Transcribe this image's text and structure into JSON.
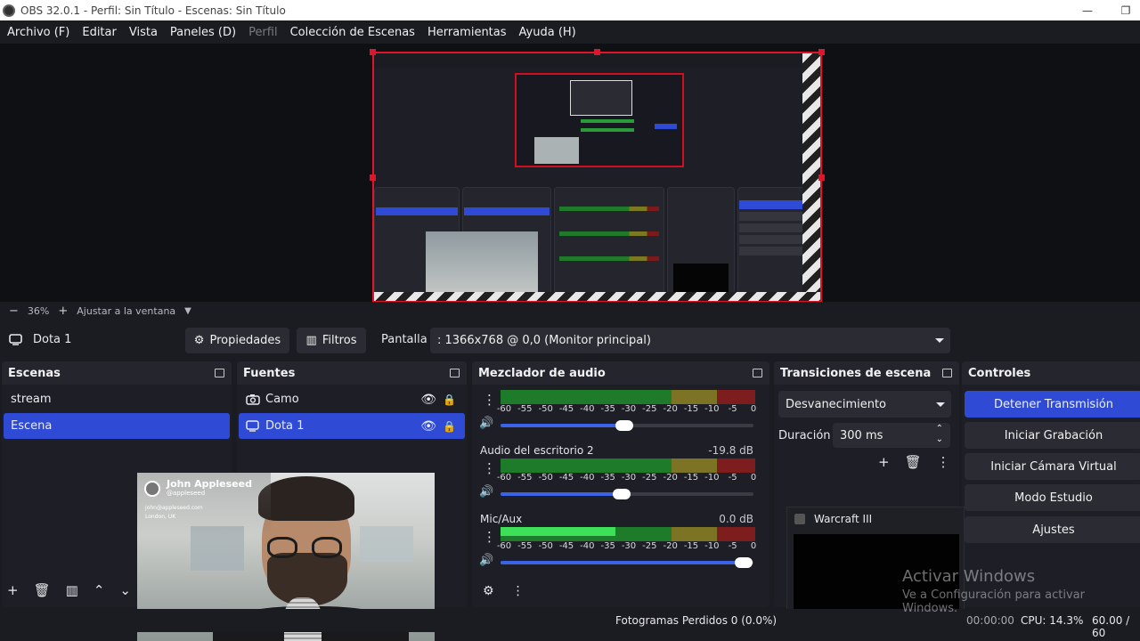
{
  "window": {
    "title": "OBS 32.0.1 - Perfil: Sin Título - Escenas: Sin Título",
    "minimize_icon": "—",
    "maximize_icon": "❐"
  },
  "menu": [
    {
      "label": "Archivo (F)",
      "enabled": true
    },
    {
      "label": "Editar",
      "enabled": true
    },
    {
      "label": "Vista",
      "enabled": true
    },
    {
      "label": "Paneles (D)",
      "enabled": true
    },
    {
      "label": "Perfil",
      "enabled": false
    },
    {
      "label": "Colección de Escenas",
      "enabled": true
    },
    {
      "label": "Herramientas",
      "enabled": true
    },
    {
      "label": "Ayuda (H)",
      "enabled": true
    }
  ],
  "zoom": {
    "minus": "−",
    "value": "36%",
    "plus": "+",
    "fit_label": "Ajustar a la ventana",
    "dropdown_icon": "▼"
  },
  "source_toolbar": {
    "source_name": "Dota 1",
    "properties_label": "Propiedades",
    "filters_label": "Filtros",
    "screen_label": "Pantalla",
    "screen_value": ": 1366x768 @ 0,0 (Monitor principal)"
  },
  "scenes": {
    "title": "Escenas",
    "items": [
      "stream",
      "Escena"
    ],
    "selected_index": 1
  },
  "sources": {
    "title": "Fuentes",
    "items": [
      {
        "name": "Camo",
        "icon": "camera-icon"
      },
      {
        "name": "Dota 1",
        "icon": "monitor-icon"
      }
    ],
    "selected_index": 1
  },
  "mixer": {
    "title": "Mezclador de audio",
    "scale": [
      "-60",
      "-55",
      "-50",
      "-45",
      "-40",
      "-35",
      "-30",
      "-25",
      "-20",
      "-15",
      "-10",
      "-5",
      "0"
    ],
    "channels": [
      {
        "name": "",
        "db": "",
        "volume": 0.49,
        "level": 0.0
      },
      {
        "name": "Audio del escritorio 2",
        "db": "-19.8 dB",
        "volume": 0.48,
        "level": 0.0
      },
      {
        "name": "Mic/Aux",
        "db": "0.0 dB",
        "volume": 0.96,
        "level": 0.45
      }
    ]
  },
  "transitions": {
    "title": "Transiciones de escena",
    "selected": "Desvanecimiento",
    "duration_label": "Duración",
    "duration_value": "300 ms"
  },
  "controls": {
    "title": "Controles",
    "buttons": [
      "Detener Transmisión",
      "Iniciar Grabación",
      "Iniciar Cámara Virtual",
      "Modo Estudio",
      "Ajustes"
    ]
  },
  "popup": {
    "title": "Warcraft III"
  },
  "webcam_overlay": {
    "name": "John Appleseed",
    "handle": "@appleseed",
    "email": "john@appleseed.com",
    "location": "London, UK"
  },
  "status": {
    "dropped_frames": "Fotogramas Perdidos 0 (0.0%)",
    "time": "00:00:00",
    "cpu": "CPU: 14.3%",
    "fps": "60.00 / 60"
  },
  "watermark": {
    "line1": "Activar Windows",
    "line2": "Ve a Configuración para activar Windows."
  }
}
